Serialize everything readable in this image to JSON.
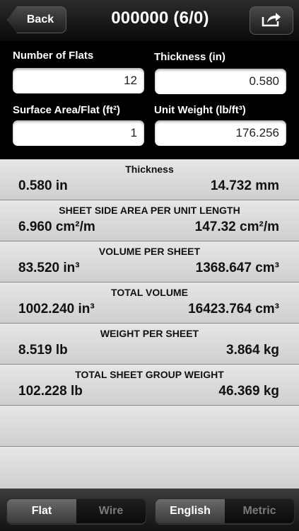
{
  "nav": {
    "back_label": "Back",
    "title": "000000 (6/0)"
  },
  "inputs": {
    "num_flats": {
      "label": "Number of Flats",
      "value": "12"
    },
    "thickness": {
      "label": "Thickness (in)",
      "value": "0.580"
    },
    "surface_area": {
      "label": "Surface Area/Flat (ft²)",
      "value": "1"
    },
    "unit_weight": {
      "label": "Unit Weight (lb/ft³)",
      "value": "176.256"
    }
  },
  "results": [
    {
      "title": "Thickness",
      "left": "0.580 in",
      "right": "14.732 mm"
    },
    {
      "title": "SHEET SIDE AREA PER UNIT LENGTH",
      "left": "6.960 cm²/m",
      "right": "147.32 cm²/m"
    },
    {
      "title": "VOLUME PER SHEET",
      "left": "83.520 in³",
      "right": "1368.647 cm³"
    },
    {
      "title": "TOTAL VOLUME",
      "left": "1002.240 in³",
      "right": "16423.764 cm³"
    },
    {
      "title": "WEIGHT PER SHEET",
      "left": "8.519 lb",
      "right": "3.864 kg"
    },
    {
      "title": "TOTAL SHEET GROUP WEIGHT",
      "left": "102.228 lb",
      "right": "46.369 kg"
    }
  ],
  "shape_segment": {
    "selected": "Flat",
    "other": "Wire"
  },
  "unit_segment": {
    "selected": "English",
    "other": "Metric"
  },
  "icons": {
    "share": "share-icon"
  }
}
